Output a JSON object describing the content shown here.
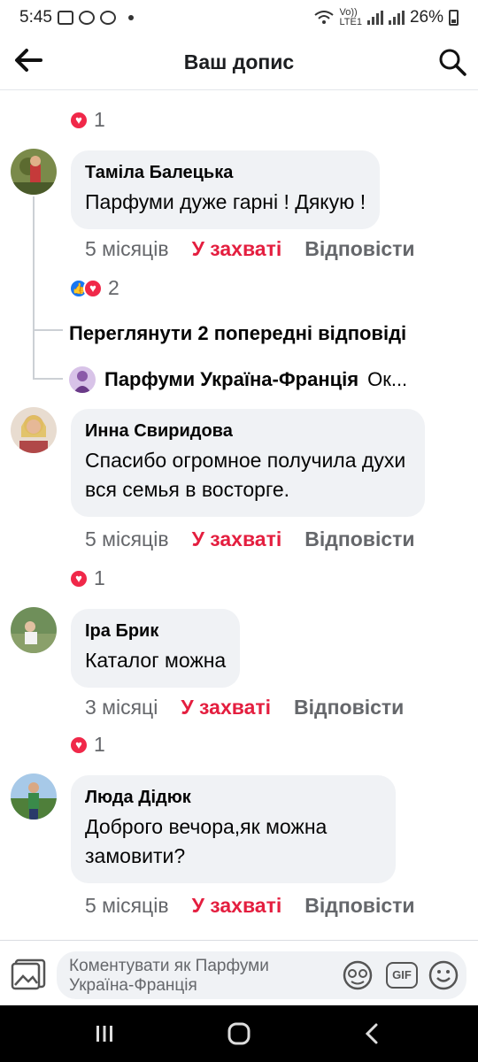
{
  "status_bar": {
    "time": "5:45",
    "battery": "26%",
    "net_top": "Vo))",
    "net_bottom": "LTE1"
  },
  "header": {
    "title": "Ваш допис"
  },
  "top_reaction": {
    "count": "1"
  },
  "comments": [
    {
      "author": "Таміла Балецька",
      "text": "Парфуми дуже гарні ! Дякую !",
      "time": "5 місяців",
      "react_label": "У захваті",
      "reply_label": "Відповісти",
      "reaction_count": "2"
    },
    {
      "author": "Инна Свиридова",
      "text": "Спасибо огромное получила духи вся семья в восторге.",
      "time": "5 місяців",
      "react_label": "У захваті",
      "reply_label": "Відповісти",
      "reaction_count": "1"
    },
    {
      "author": "Іра Брик",
      "text": "Каталог можна",
      "time": "3 місяці",
      "react_label": "У захваті",
      "reply_label": "Відповісти",
      "reaction_count": "1"
    },
    {
      "author": "Люда Дідюк",
      "text": "Доброго вечора,як можна замовити?",
      "time": "5 місяців",
      "react_label": "У захваті",
      "reply_label": "Відповісти"
    }
  ],
  "thread": {
    "view_previous": "Переглянути 2 попередні відповіді",
    "reply_author": "Парфуми Україна-Франція",
    "reply_snippet": "Ок..."
  },
  "composer": {
    "placeholder": "Коментувати як Парфуми Україна-Франція",
    "gif_label": "GIF"
  },
  "colors": {
    "accent_red": "#e41e3f",
    "bubble": "#f0f2f5",
    "meta": "#65676b"
  }
}
